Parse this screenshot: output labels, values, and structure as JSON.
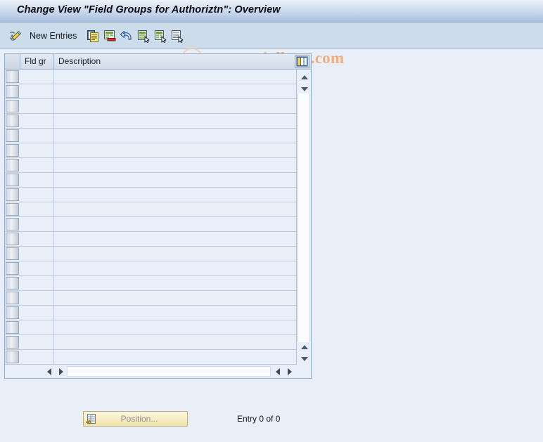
{
  "window": {
    "title": "Change View \"Field Groups for Authoriztn\": Overview"
  },
  "toolbar": {
    "edit_icon": "pencil-edit-icon",
    "new_entries_label": "New Entries",
    "buttons": [
      {
        "name": "copy-as-icon",
        "icon": "copy-documents-icon"
      },
      {
        "name": "delete-entry-icon",
        "icon": "document-delete-icon"
      },
      {
        "name": "undo-change-icon",
        "icon": "undo-arrow-icon"
      },
      {
        "name": "select-all-icon",
        "icon": "table-select-all-icon"
      },
      {
        "name": "deselect-all-icon",
        "icon": "table-deselect-all-icon"
      },
      {
        "name": "select-block-icon",
        "icon": "table-select-block-icon"
      }
    ]
  },
  "watermark": {
    "text": "www.tutorialkart.com",
    "color": "#eeaf7b"
  },
  "table": {
    "columns": [
      {
        "key": "select",
        "label": ""
      },
      {
        "key": "fld_gr",
        "label": "Fld gr"
      },
      {
        "key": "description",
        "label": "Description"
      }
    ],
    "rows": [],
    "empty_row_count": 20,
    "config_icon": "table-settings-icon"
  },
  "scrollbars": {
    "vertical": {
      "up_icon": "scroll-up-icon",
      "down_icon": "scroll-down-icon",
      "bottom_up_icon": "scroll-up-icon",
      "bottom_down_icon": "scroll-down-icon"
    },
    "horizontal": {
      "left_icon": "scroll-left-icon",
      "right_icon": "scroll-right-icon",
      "far_left_icon": "scroll-left-icon",
      "far_right_icon": "scroll-right-icon"
    }
  },
  "footer": {
    "position_button": {
      "label": "Position...",
      "icon": "position-goto-icon",
      "enabled": false
    },
    "entry_status": "Entry 0 of 0"
  },
  "colors": {
    "page_background": "#e9eff8",
    "titlebar_gradient_end": "#a5bfdd",
    "toolbar_background": "#ccdceb",
    "grid_border": "#93aecb",
    "watermark": "#eeaf7b",
    "button_yellow": "#f7eec4"
  }
}
